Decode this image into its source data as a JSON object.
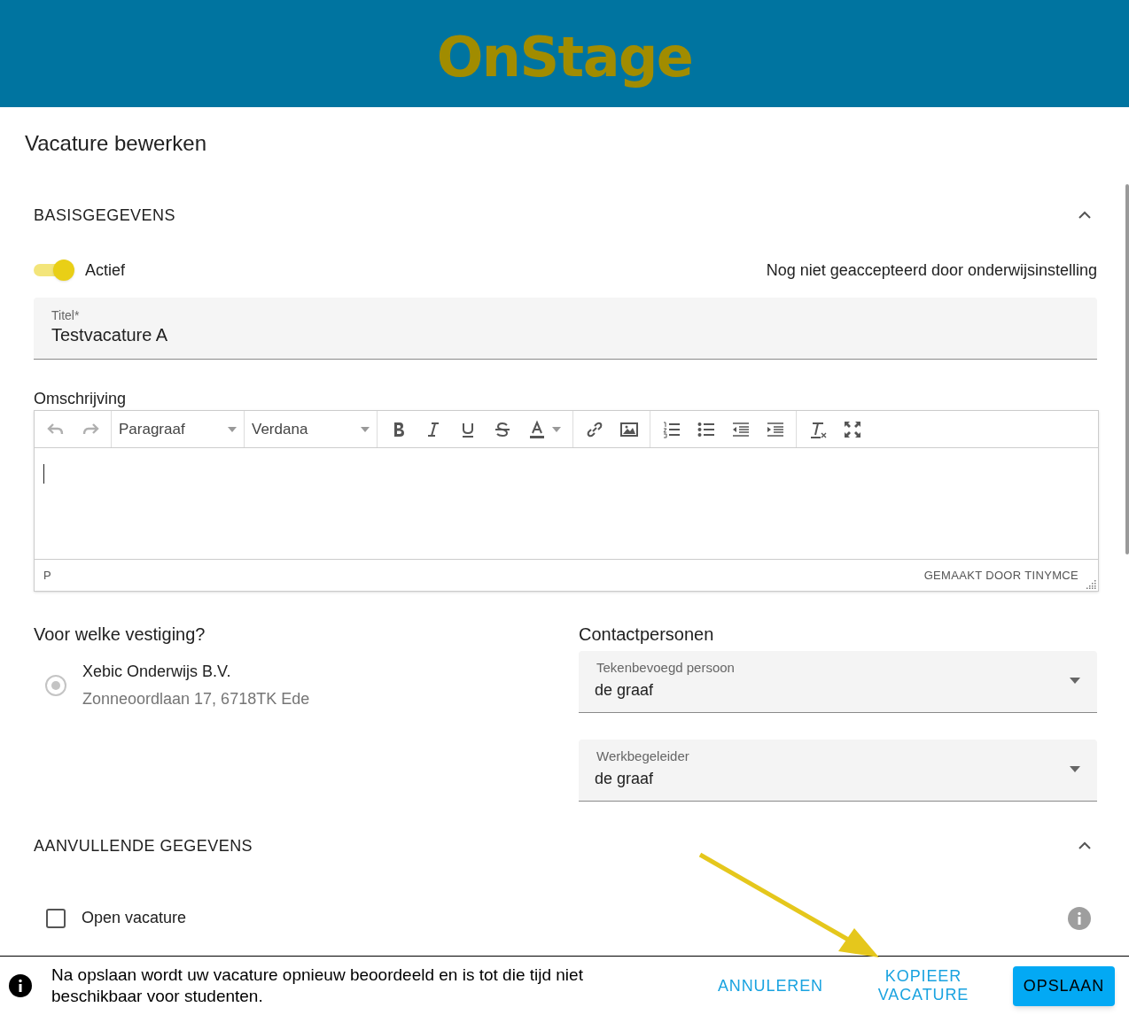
{
  "header": {
    "logo": "OnStage"
  },
  "page_title": "Vacature bewerken",
  "sections": [
    {
      "title": "BASISGEGEVENS",
      "expanded": true
    },
    {
      "title": "AANVULLENDE GEGEVENS",
      "expanded": true
    }
  ],
  "active_toggle": {
    "label": "Actief",
    "on": true
  },
  "approval_status": "Nog niet geaccepteerd door onderwijsinstelling",
  "title_field": {
    "label": "Titel*",
    "value": "Testvacature A"
  },
  "description": {
    "label": "Omschrijving",
    "toolbar": [
      [
        {
          "kind": "undo",
          "disabled": true
        },
        {
          "kind": "redo",
          "disabled": true
        }
      ],
      [
        {
          "kind": "dropdown",
          "label": "Paragraaf"
        }
      ],
      [
        {
          "kind": "dropdown",
          "label": "Verdana"
        }
      ],
      [
        {
          "kind": "bold",
          "disabled": false
        },
        {
          "kind": "italic",
          "disabled": false
        },
        {
          "kind": "underline",
          "disabled": false
        },
        {
          "kind": "strike",
          "disabled": false
        },
        {
          "kind": "textcolor",
          "disabled": false
        }
      ],
      [
        {
          "kind": "link",
          "disabled": false
        },
        {
          "kind": "image",
          "disabled": false
        }
      ],
      [
        {
          "kind": "numlist",
          "disabled": false
        },
        {
          "kind": "bullist",
          "disabled": false
        },
        {
          "kind": "outdent",
          "disabled": false
        },
        {
          "kind": "indent",
          "disabled": false
        }
      ],
      [
        {
          "kind": "clearformat",
          "disabled": false
        },
        {
          "kind": "fullscreen",
          "disabled": false
        }
      ]
    ],
    "path": "P",
    "branding": "GEMAAKT DOOR TINYMCE"
  },
  "location": {
    "heading": "Voor welke vestiging?",
    "options": [
      {
        "name": "Xebic Onderwijs B.V.",
        "address": "Zonneoordlaan 17, 6718TK Ede",
        "selected": true
      }
    ]
  },
  "contacts": {
    "heading": "Contactpersonen",
    "fields": [
      {
        "label": "Tekenbevoegd persoon",
        "value": "de graaf"
      },
      {
        "label": "Werkbegeleider",
        "value": "de graaf"
      }
    ]
  },
  "open_vacancy": {
    "label": "Open vacature",
    "checked": false
  },
  "footer": {
    "message": "Na opslaan wordt uw vacature opnieuw beoordeeld en is tot die tijd niet beschikbaar voor studenten.",
    "cancel": "ANNULEREN",
    "copy": "KOPIEER VACATURE",
    "save": "OPSLAAN"
  }
}
